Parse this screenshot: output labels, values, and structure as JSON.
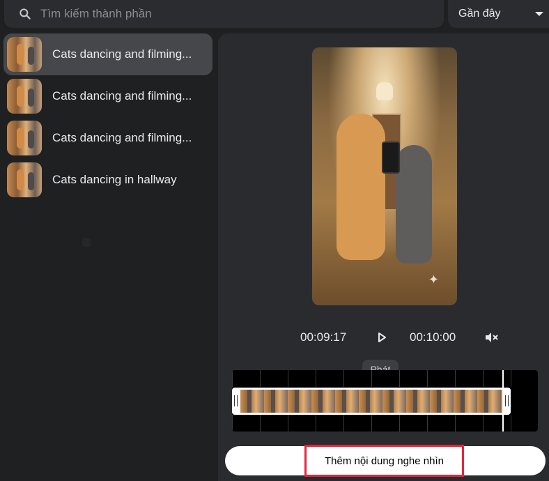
{
  "search": {
    "placeholder": "Tìm kiếm thành phần",
    "icon": "search-icon"
  },
  "sort": {
    "selected": "Gần đây",
    "icon": "chevron-down-icon"
  },
  "items": [
    {
      "label": "Cats dancing and filming...",
      "selected": true
    },
    {
      "label": "Cats dancing and filming...",
      "selected": false
    },
    {
      "label": "Cats dancing and filming...",
      "selected": false
    },
    {
      "label": "Cats dancing in hallway",
      "selected": false
    }
  ],
  "player": {
    "current_time": "00:09:17",
    "total_time": "00:10:00",
    "play_icon": "play-icon",
    "mute_icon": "volume-off-icon",
    "tooltip": "Phát"
  },
  "actions": {
    "add_label": "Thêm nội dung nghe nhìn",
    "highlight_color": "#e8243c"
  },
  "colors": {
    "background": "#1f2022",
    "panel": "#2a2b2e",
    "selected_item": "#45474a"
  }
}
